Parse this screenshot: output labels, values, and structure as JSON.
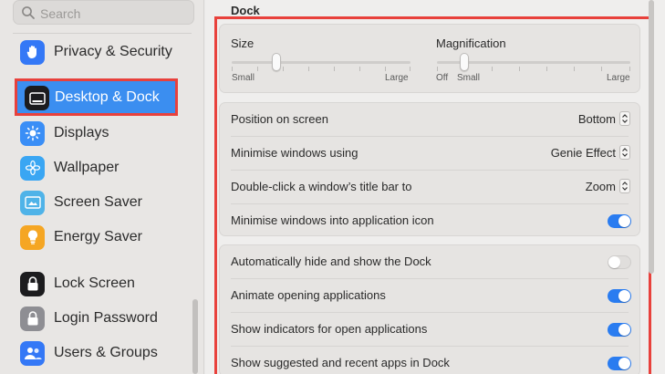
{
  "search": {
    "placeholder": "Search"
  },
  "sidebar": {
    "items": [
      {
        "label": "Privacy & Security",
        "icon": "hand-icon",
        "color": "#3478f6"
      },
      {
        "label": "Desktop & Dock",
        "icon": "dock-icon",
        "color": "#1c1c1e",
        "selected": true
      },
      {
        "label": "Displays",
        "icon": "sun-icon",
        "color": "#3a8ef6"
      },
      {
        "label": "Wallpaper",
        "icon": "flower-icon",
        "color": "#3aa6f3"
      },
      {
        "label": "Screen Saver",
        "icon": "screen-saver-icon",
        "color": "#4fb3e8"
      },
      {
        "label": "Energy Saver",
        "icon": "bulb-icon",
        "color": "#f5a623"
      },
      {
        "label": "Lock Screen",
        "icon": "lock-icon",
        "color": "#1c1c1e"
      },
      {
        "label": "Login Password",
        "icon": "lock-icon",
        "color": "#8e8e93"
      },
      {
        "label": "Users & Groups",
        "icon": "users-icon",
        "color": "#3478f6"
      }
    ]
  },
  "main": {
    "section_title": "Dock",
    "size": {
      "title": "Size",
      "min_label": "Small",
      "max_label": "Large",
      "value_fraction": 0.25
    },
    "magnification": {
      "title": "Magnification",
      "off_label": "Off",
      "min_label": "Small",
      "max_label": "Large",
      "value_fraction": 0.14
    },
    "rows": [
      {
        "label": "Position on screen",
        "type": "popup",
        "value": "Bottom"
      },
      {
        "label": "Minimise windows using",
        "type": "popup",
        "value": "Genie Effect"
      },
      {
        "label": "Double-click a window’s title bar to",
        "type": "popup",
        "value": "Zoom"
      },
      {
        "label": "Minimise windows into application icon",
        "type": "toggle",
        "on": true
      }
    ],
    "rows2": [
      {
        "label": "Automatically hide and show the Dock",
        "type": "toggle",
        "on": false
      },
      {
        "label": "Animate opening applications",
        "type": "toggle",
        "on": true
      },
      {
        "label": "Show indicators for open applications",
        "type": "toggle",
        "on": true
      },
      {
        "label": "Show suggested and recent apps in Dock",
        "type": "toggle",
        "on": true
      }
    ]
  },
  "colors": {
    "accent": "#2a7cf0",
    "selection": "#3b8ef0",
    "highlight_border": "#e8413c"
  }
}
